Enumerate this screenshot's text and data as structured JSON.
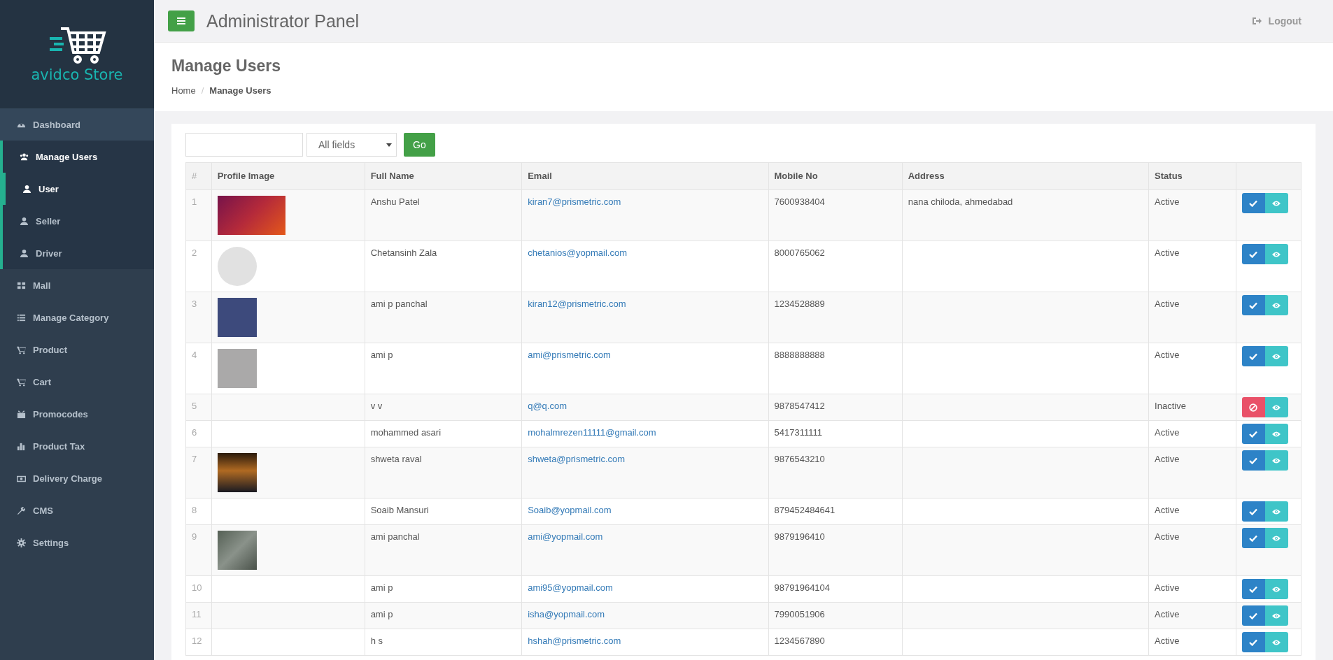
{
  "brand": {
    "name": "avidco Store"
  },
  "sidebar": {
    "items": [
      {
        "label": "Dashboard",
        "selected": false,
        "highlight": true
      },
      {
        "label": "Manage Users",
        "selected": false,
        "highlight": false,
        "expanded": true,
        "children": [
          {
            "label": "User",
            "selected": true
          },
          {
            "label": "Seller",
            "selected": false
          },
          {
            "label": "Driver",
            "selected": false
          }
        ]
      },
      {
        "label": "Mall",
        "selected": false,
        "highlight": false
      },
      {
        "label": "Manage Category",
        "selected": false,
        "highlight": false
      },
      {
        "label": "Product",
        "selected": false,
        "highlight": false
      },
      {
        "label": "Cart",
        "selected": false,
        "highlight": false
      },
      {
        "label": "Promocodes",
        "selected": false,
        "highlight": false
      },
      {
        "label": "Product Tax",
        "selected": false,
        "highlight": false
      },
      {
        "label": "Delivery Charge",
        "selected": false,
        "highlight": false
      },
      {
        "label": "CMS",
        "selected": false,
        "highlight": false
      },
      {
        "label": "Settings",
        "selected": false,
        "highlight": false
      }
    ]
  },
  "header": {
    "title": "Administrator Panel",
    "logout": "Logout"
  },
  "page": {
    "title": "Manage Users",
    "breadcrumb": [
      {
        "label": "Home",
        "current": false
      },
      {
        "label": "Manage Users",
        "current": true
      }
    ],
    "separator": "/"
  },
  "filter": {
    "select": "All fields",
    "button": "Go"
  },
  "table": {
    "columns": [
      "#",
      "Profile Image",
      "Full Name",
      "Email",
      "Mobile No",
      "Address",
      "Status"
    ],
    "rows": [
      {
        "no": "1",
        "kind": "banner",
        "name": "Anshu Patel",
        "email": "kiran7@prismetric.com",
        "mobile": "7600938404",
        "address": "nana chiloda, ahmedabad",
        "status": "Active",
        "active": true
      },
      {
        "no": "2",
        "kind": "circle",
        "name": "Chetansinh Zala",
        "email": "chetanios@yopmail.com",
        "mobile": "8000765062",
        "status": "Active",
        "active": true
      },
      {
        "no": "3",
        "kind": "avatar",
        "name": "ami p panchal",
        "email": "kiran12@prismetric.com",
        "mobile": "1234528889",
        "status": "Active",
        "active": true
      },
      {
        "no": "4",
        "kind": "photo",
        "name": "ami p",
        "email": "ami@prismetric.com",
        "mobile": "8888888888",
        "status": "Active",
        "active": true
      },
      {
        "no": "5",
        "kind": "plain",
        "name": "v v",
        "email": "q@q.com",
        "mobile": "9878547412",
        "status": "Inactive",
        "active": false
      },
      {
        "no": "6",
        "kind": "plain",
        "name": "mohammed asari",
        "email": "mohalmrezen11111@gmail.com",
        "mobile": "5417311111",
        "status": "Active",
        "active": true
      },
      {
        "no": "7",
        "kind": "photo",
        "name": "shweta raval",
        "email": "shweta@prismetric.com",
        "mobile": "9876543210",
        "status": "Active",
        "active": true
      },
      {
        "no": "8",
        "kind": "plain",
        "name": "Soaib Mansuri",
        "email": "Soaib@yopmail.com",
        "mobile": "879452484641",
        "status": "Active",
        "active": true
      },
      {
        "no": "9",
        "kind": "photo",
        "name": "ami panchal",
        "email": "ami@yopmail.com",
        "mobile": "9879196410",
        "status": "Active",
        "active": true
      },
      {
        "no": "10",
        "kind": "plain",
        "name": "ami p",
        "email": "ami95@yopmail.com",
        "mobile": "98791964104",
        "status": "Active",
        "active": true
      },
      {
        "no": "11",
        "kind": "plain",
        "name": "ami p",
        "email": "isha@yopmail.com",
        "mobile": "7990051906",
        "status": "Active",
        "active": true
      },
      {
        "no": "12",
        "kind": "plain",
        "name": "h s",
        "email": "hshah@prismetric.com",
        "mobile": "1234567890",
        "status": "Active",
        "active": true
      }
    ]
  }
}
